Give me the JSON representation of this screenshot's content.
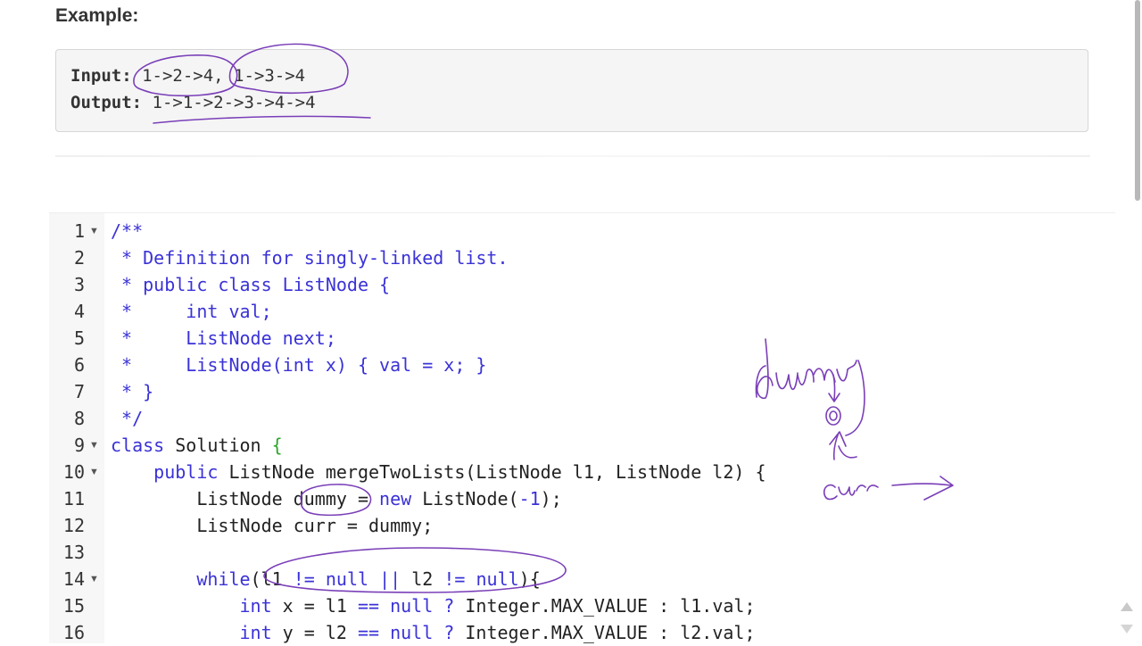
{
  "example": {
    "heading": "Example:",
    "input_label": "Input:",
    "input_value": " 1->2->4, 1->3->4",
    "output_label": "Output:",
    "output_value": " 1->1->2->3->4->4"
  },
  "editor": {
    "lines": [
      {
        "n": "1",
        "fold": true
      },
      {
        "n": "2"
      },
      {
        "n": "3"
      },
      {
        "n": "4"
      },
      {
        "n": "5"
      },
      {
        "n": "6"
      },
      {
        "n": "7"
      },
      {
        "n": "8"
      },
      {
        "n": "9",
        "fold": true
      },
      {
        "n": "10",
        "fold": true
      },
      {
        "n": "11"
      },
      {
        "n": "12"
      },
      {
        "n": "13"
      },
      {
        "n": "14",
        "fold": true
      },
      {
        "n": "15"
      },
      {
        "n": "16"
      }
    ],
    "code": {
      "l1": "/**",
      "l2": " * Definition for singly-linked list.",
      "l3": " * public class ListNode {",
      "l4": " *     int val;",
      "l5": " *     ListNode next;",
      "l6": " *     ListNode(int x) { val = x; }",
      "l7": " * }",
      "l8": " */",
      "l9_kw": "class",
      "l9_name": " Solution ",
      "l9_brace": "{",
      "l10_kw": "    public",
      "l10_rest": " ListNode mergeTwoLists(ListNode l1, ListNode l2) {",
      "l11_a": "        ListNode dummy = ",
      "l11_kw": "new",
      "l11_b": " ListNode(",
      "l11_num": "-1",
      "l11_c": ");",
      "l12": "        ListNode curr = dummy;",
      "l13": "",
      "l14_kw": "        while",
      "l14_a": "(l1 ",
      "l14_op1": "!=",
      "l14_sp1": " ",
      "l14_null1": "null",
      "l14_sp2": " ",
      "l14_or": "||",
      "l14_b": " l2 ",
      "l14_op2": "!=",
      "l14_sp3": " ",
      "l14_null2": "null",
      "l14_c": "){",
      "l15_kw": "            int",
      "l15_a": " x = l1 ",
      "l15_op": "==",
      "l15_sp": " ",
      "l15_null": "null",
      "l15_q": " ? ",
      "l15_b": "Integer.MAX_VALUE : l1.val;",
      "l16_kw": "            int",
      "l16_a": " y = l2 ",
      "l16_op": "==",
      "l16_sp": " ",
      "l16_null": "null",
      "l16_q": " ? ",
      "l16_b": "Integer.MAX_VALUE : l2.val;"
    }
  },
  "annotations": {
    "dummy_note": "dummy",
    "curr_note": "curr"
  },
  "colors": {
    "keyword": "#3a32d6",
    "brace_highlight": "#2aa52a",
    "ink": "#7a3fb8"
  }
}
